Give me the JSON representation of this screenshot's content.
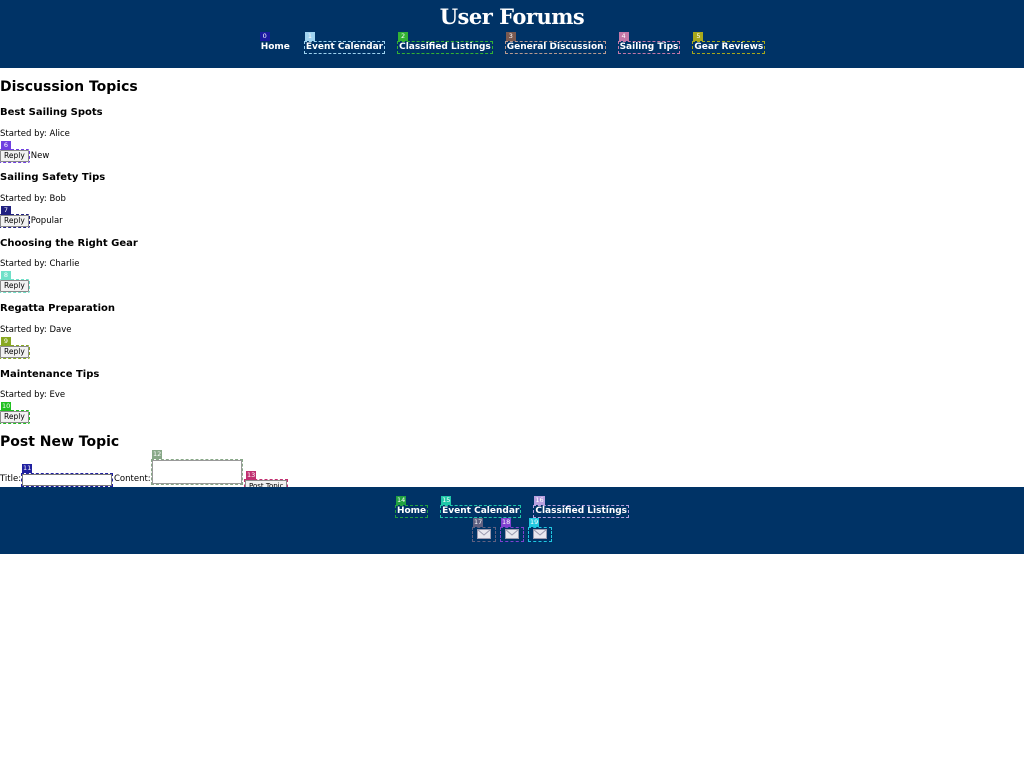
{
  "header": {
    "title": "User Forums",
    "nav": [
      "Home",
      "Event Calendar",
      "Classified Listings",
      "General Discussion",
      "Sailing Tips",
      "Gear Reviews"
    ]
  },
  "topics_section": {
    "title": "Discussion Topics",
    "topics": [
      {
        "title": "Best Sailing Spots",
        "started_by": "Started by: Alice",
        "reply_label": "Reply",
        "tag": "New"
      },
      {
        "title": "Sailing Safety Tips",
        "started_by": "Started by: Bob",
        "reply_label": "Reply",
        "tag": "Popular"
      },
      {
        "title": "Choosing the Right Gear",
        "started_by": "Started by: Charlie",
        "reply_label": "Reply",
        "tag": ""
      },
      {
        "title": "Regatta Preparation",
        "started_by": "Started by: Dave",
        "reply_label": "Reply",
        "tag": ""
      },
      {
        "title": "Maintenance Tips",
        "started_by": "Started by: Eve",
        "reply_label": "Reply",
        "tag": ""
      }
    ]
  },
  "post_form": {
    "title": "Post New Topic",
    "title_label": "Title:",
    "content_label": "Content:",
    "submit_label": "Post Topic"
  },
  "footer": {
    "nav": [
      "Home",
      "Event Calendar",
      "Classified Listings"
    ],
    "social_icons": [
      "mail-icon",
      "mail-icon",
      "mail-icon"
    ]
  },
  "annotation_badges": [
    "0",
    "1",
    "2",
    "3",
    "4",
    "5",
    "6",
    "7",
    "8",
    "9",
    "10",
    "11",
    "12",
    "13",
    "14",
    "15",
    "16",
    "17",
    "18",
    "19"
  ],
  "colors": {
    "header_bg": "#003366",
    "footer_bg": "#003366",
    "badge_0": "#1a1aa0",
    "badge_1": "#9fd3f0",
    "badge_2": "#33b233",
    "badge_3": "#7a5a50",
    "badge_4": "#c478a8",
    "badge_5": "#a8a81a",
    "badge_6": "#7040e0",
    "badge_7": "#202080",
    "badge_8": "#70e0c8",
    "badge_9": "#88a820",
    "badge_10": "#20c020",
    "badge_11": "#2020a0",
    "badge_12": "#88a888",
    "badge_13": "#c03070",
    "badge_14": "#20a040",
    "badge_15": "#20c8a8",
    "badge_16": "#b8a0e0",
    "badge_17": "#606080",
    "badge_18": "#8040d0",
    "badge_19": "#20c8e0"
  }
}
